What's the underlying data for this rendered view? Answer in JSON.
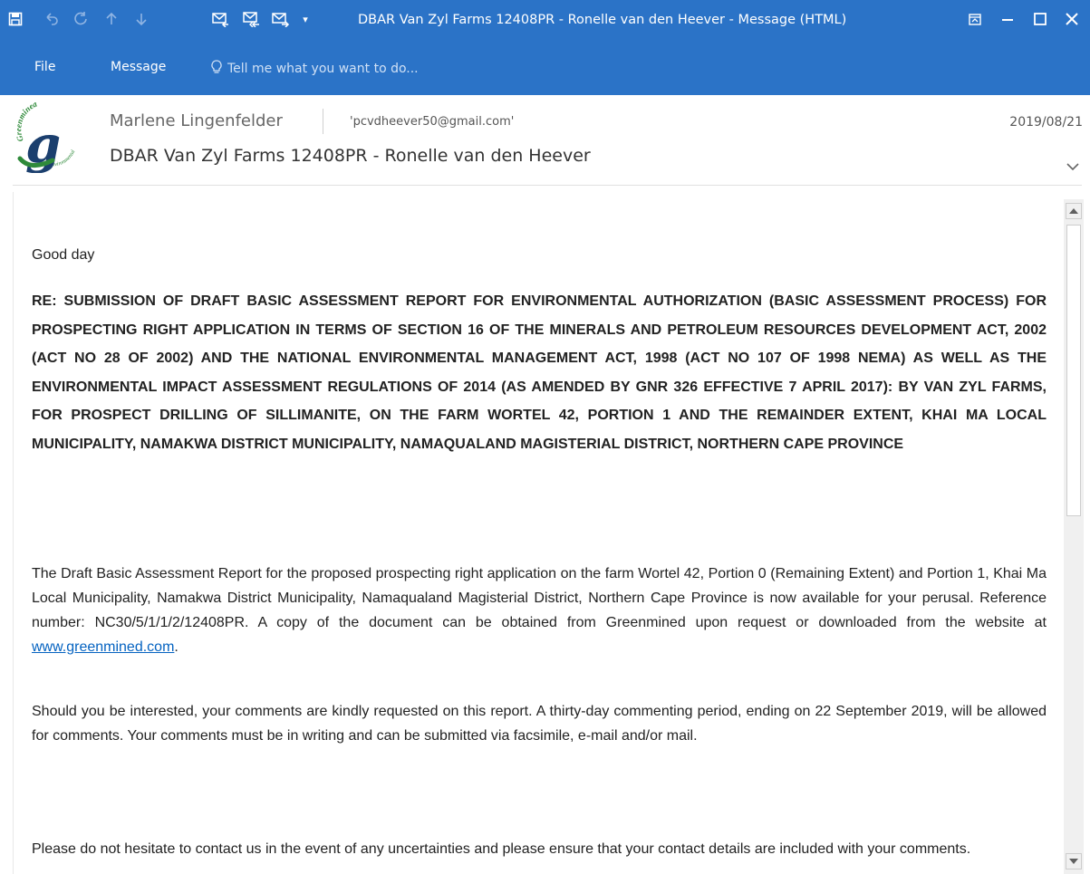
{
  "window": {
    "title": "DBAR Van Zyl Farms 12408PR - Ronelle van den Heever - Message (HTML)"
  },
  "ribbon": {
    "tabs": [
      "File",
      "Message"
    ],
    "tell_me_placeholder": "Tell me what you want to do..."
  },
  "header": {
    "sender": "Marlene Lingenfelder",
    "recipient": "'pcvdheever50@gmail.com'",
    "date": "2019/08/21",
    "subject": "DBAR Van Zyl Farms 12408PR - Ronelle van den Heever"
  },
  "body": {
    "greeting": "Good day",
    "re_line": "RE: SUBMISSION OF DRAFT BASIC ASSESSMENT REPORT FOR ENVIRONMENTAL AUTHORIZATION (BASIC ASSESSMENT PROCESS) FOR PROSPECTING RIGHT APPLICATION IN TERMS OF SECTION 16 OF THE MINERALS AND PETROLEUM RESOURCES DEVELOPMENT ACT, 2002 (ACT NO 28 OF 2002) AND THE NATIONAL ENVIRONMENTAL MANAGEMENT ACT, 1998 (ACT NO 107 OF 1998 NEMA) AS WELL AS THE ENVIRONMENTAL IMPACT ASSESSMENT REGULATIONS OF 2014 (AS AMENDED BY GNR 326 EFFECTIVE 7 APRIL 2017): BY VAN ZYL FARMS, FOR PROSPECT DRILLING OF SILLIMANITE, ON THE FARM WORTEL 42, PORTION 1 AND THE REMAINDER EXTENT, KHAI MA LOCAL MUNICIPALITY, NAMAKWA DISTRICT MUNICIPALITY, NAMAQUALAND MAGISTERIAL DISTRICT, NORTHERN CAPE PROVINCE",
    "para1_text": "The Draft Basic Assessment Report for the proposed prospecting right application on the farm Wortel 42, Portion 0 (Remaining Extent) and Portion 1, Khai Ma Local Municipality, Namakwa District Municipality, Namaqualand Magisterial District, Northern Cape Province is now available for your perusal. Reference number: NC30/5/1/1/2/12408PR.  A copy of the document can be obtained from Greenmined upon request or downloaded from the website at ",
    "para1_link": "www.greenmined.com",
    "para1_end": ".",
    "para2": "Should you be interested, your comments are kindly requested on this report. A thirty-day commenting period, ending on 22 September 2019, will be allowed for comments. Your comments must be in writing and can be submitted via facsimile, e-mail and/or mail.",
    "para3": "Please do not hesitate to contact us in the event of any uncertainties and please ensure that your contact details are included with your comments."
  },
  "logo": {
    "text_top": "Greenmined",
    "text_bottom": "Environmental",
    "letter": "g"
  },
  "colors": {
    "titlebar": "#2b73c7",
    "link": "#0563c1",
    "logo_green": "#2f8a3a",
    "logo_dark": "#1b3f6e"
  }
}
